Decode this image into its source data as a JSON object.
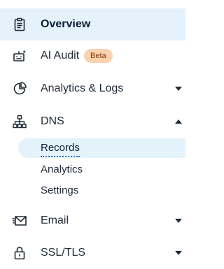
{
  "nav": {
    "overview": {
      "label": "Overview",
      "icon": "clipboard-icon"
    },
    "ai_audit": {
      "label": "AI Audit",
      "badge": "Beta",
      "icon": "robot-icon"
    },
    "analytics_logs": {
      "label": "Analytics & Logs",
      "icon": "pie-chart-icon",
      "expanded": false
    },
    "dns": {
      "label": "DNS",
      "icon": "sitemap-icon",
      "expanded": true,
      "children": [
        {
          "label": "Records",
          "active": true
        },
        {
          "label": "Analytics",
          "active": false
        },
        {
          "label": "Settings",
          "active": false
        }
      ]
    },
    "email": {
      "label": "Email",
      "icon": "envelope-icon",
      "expanded": false
    },
    "ssl_tls": {
      "label": "SSL/TLS",
      "icon": "lock-icon",
      "expanded": false
    }
  },
  "colors": {
    "active_bg": "#e6f2fb",
    "badge_bg": "#fbd2ad",
    "badge_text": "#7a3c11",
    "text": "#1f2a37"
  }
}
